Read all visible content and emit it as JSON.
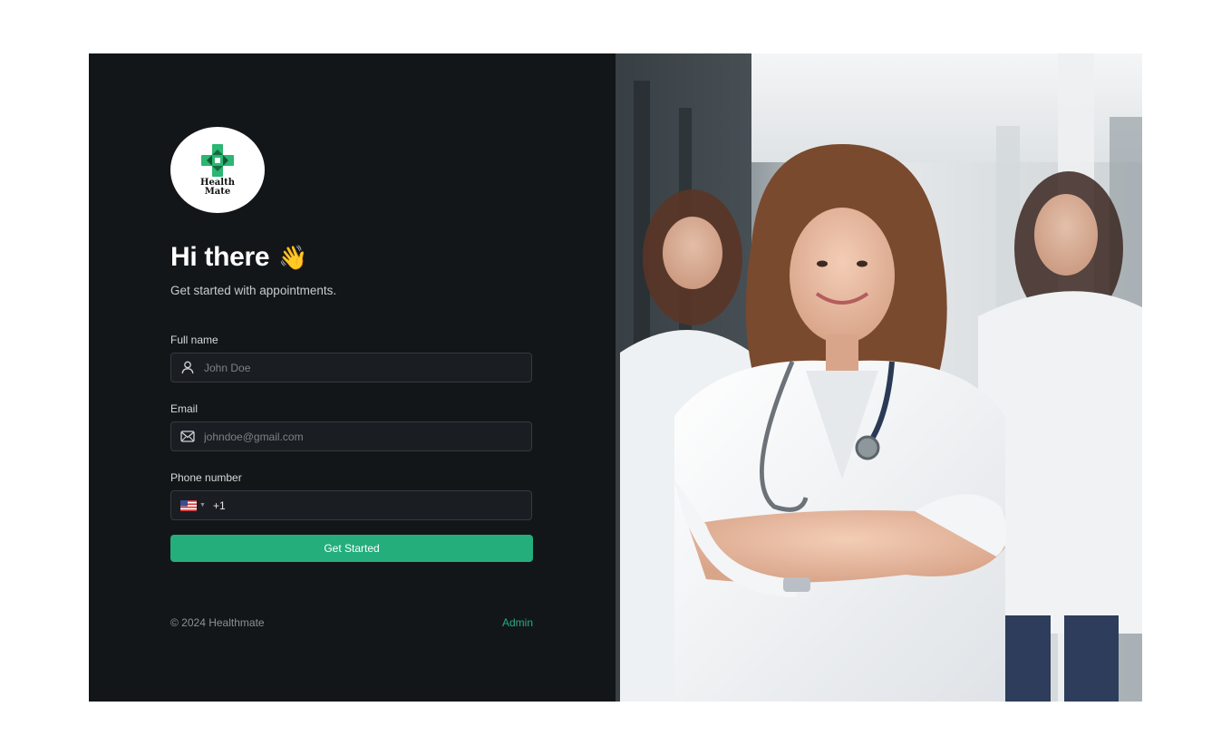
{
  "logo": {
    "line1": "Health",
    "line2": "Mate",
    "icon": "medical-cross-icon"
  },
  "greeting": {
    "title": "Hi there",
    "emoji": "👋"
  },
  "subtitle": "Get started with appointments.",
  "form": {
    "full_name": {
      "label": "Full name",
      "placeholder": "John Doe",
      "value": "",
      "icon": "user-icon"
    },
    "email": {
      "label": "Email",
      "placeholder": "johndoe@gmail.com",
      "value": "",
      "icon": "mail-icon"
    },
    "phone": {
      "label": "Phone number",
      "country": "US",
      "code": "+1",
      "value": ""
    }
  },
  "submit_label": "Get Started",
  "footer": {
    "copyright": "© 2024 Healthmate",
    "admin_link": "Admin"
  },
  "colors": {
    "panel_bg": "#131619",
    "accent": "#24ae7c",
    "input_bg": "#1a1d21",
    "input_border": "#363a3f"
  }
}
